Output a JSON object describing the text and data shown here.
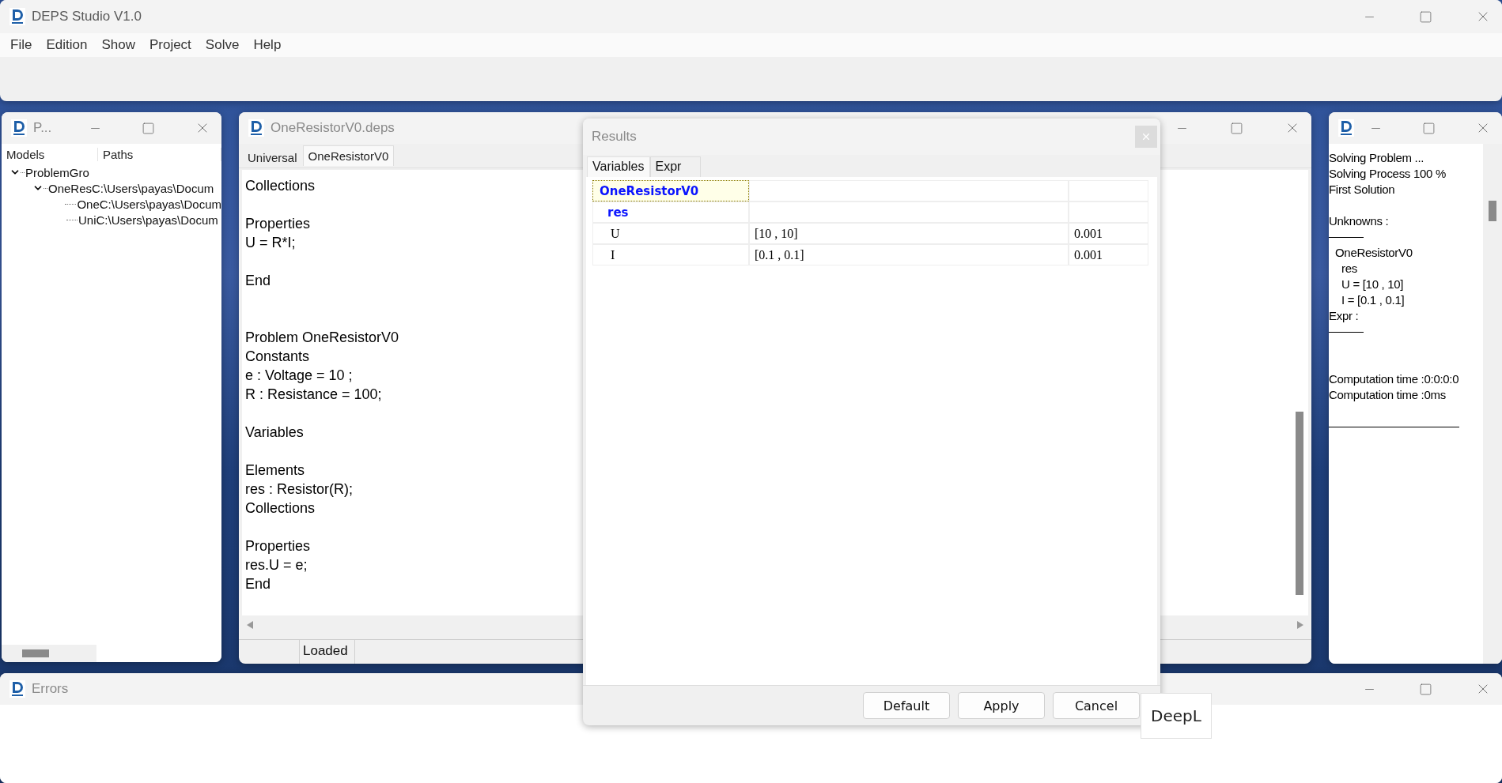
{
  "main_window": {
    "title": "DEPS Studio V1.0",
    "menu": [
      "File",
      "Edition",
      "Show",
      "Project",
      "Solve",
      "Help"
    ]
  },
  "project_window": {
    "title": "P...",
    "columns": [
      "Models",
      "Paths"
    ],
    "tree": [
      {
        "label": "ProblemGro",
        "expanded": true,
        "children": [
          {
            "label": "OneRes",
            "path": "C:\\Users\\payas\\Docum",
            "expanded": true,
            "children": [
              {
                "label": "One",
                "path": "C:\\Users\\payas\\Docum"
              },
              {
                "label": "Uni",
                "path": "C:\\Users\\payas\\Docum"
              }
            ]
          }
        ]
      }
    ]
  },
  "editor_window": {
    "title": "OneResistorV0.deps",
    "tabs": [
      {
        "label": "Universal",
        "selected": false
      },
      {
        "label": "OneResistorV0",
        "selected": true
      }
    ],
    "sections": [
      {
        "blocks": [
          [
            "Collections"
          ],
          [
            "Properties",
            "U = R*I;"
          ],
          [
            "End"
          ]
        ]
      },
      {
        "blocks": [
          [
            "Problem OneResistorV0",
            "Constants",
            "e : Voltage = 10 ;",
            "R : Resistance = 100;"
          ],
          [
            "Variables"
          ],
          [
            "Elements",
            "res : Resistor(R);",
            "Collections"
          ],
          [
            "Properties",
            "res.U = e;",
            "End"
          ]
        ]
      }
    ],
    "status": "Loaded"
  },
  "results_dialog": {
    "title": "Results",
    "tabs": [
      {
        "label": "Variables",
        "selected": true
      },
      {
        "label": "Expr",
        "selected": false
      }
    ],
    "rows": [
      {
        "kind": "model",
        "name": "OneResistorV0",
        "selected": true
      },
      {
        "kind": "element",
        "name": "res",
        "selected": false
      },
      {
        "kind": "variable",
        "name": "U",
        "value": "[10 , 10]",
        "precision": "0.001",
        "selected": false
      },
      {
        "kind": "variable",
        "name": "I",
        "value": "[0.1 , 0.1]",
        "precision": "0.001",
        "selected": false
      }
    ],
    "buttons": [
      "Default",
      "Apply",
      "Cancel"
    ]
  },
  "output_window": {
    "lines": [
      {
        "kind": "text",
        "text": "Solving Problem ..."
      },
      {
        "kind": "text",
        "text": "Solving Process 100 %"
      },
      {
        "kind": "text",
        "text": "First Solution"
      },
      {
        "kind": "blank"
      },
      {
        "kind": "text",
        "text": "Unknowns :"
      },
      {
        "kind": "rule"
      },
      {
        "kind": "tree",
        "text": "OneResistorV0",
        "children": [
          "res",
          "U = [10 , 10]",
          "I = [0.1 , 0.1]"
        ]
      },
      {
        "kind": "text",
        "text": "Expr :"
      },
      {
        "kind": "rule"
      },
      {
        "kind": "blank"
      },
      {
        "kind": "blank"
      },
      {
        "kind": "text",
        "text": "Computation time :0:0:0:0"
      },
      {
        "kind": "text",
        "text": "Computation time :0ms"
      },
      {
        "kind": "blank"
      },
      {
        "kind": "long_rule"
      }
    ]
  },
  "errors_window": {
    "title": "Errors"
  },
  "popup": {
    "text": "DeepL"
  }
}
